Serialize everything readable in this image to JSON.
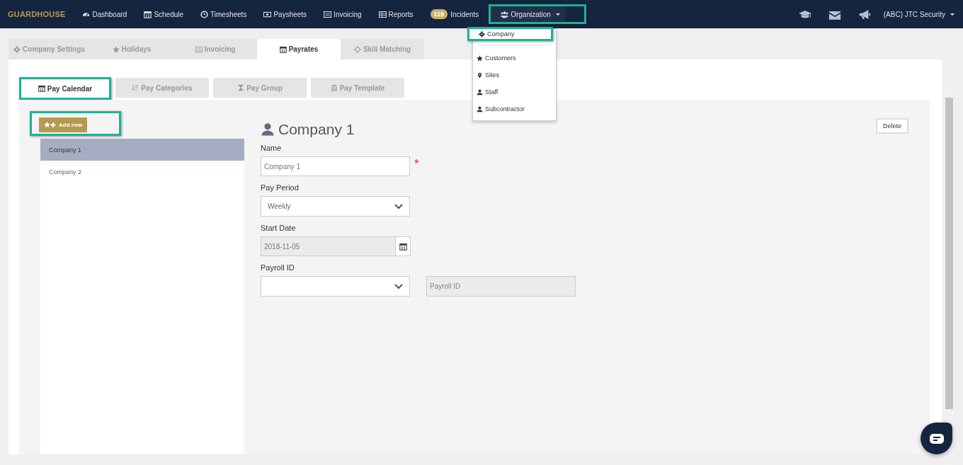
{
  "brand": "GUARDHOUSE",
  "nav": [
    {
      "label": "Dashboard",
      "highlighted": false
    },
    {
      "label": "Schedule",
      "highlighted": false
    },
    {
      "label": "Timesheets",
      "highlighted": false
    },
    {
      "label": "Paysheets",
      "highlighted": false
    },
    {
      "label": "Invoicing",
      "highlighted": false
    },
    {
      "label": "Reports",
      "highlighted": false
    },
    {
      "label": "Incidents",
      "badge": "119",
      "highlighted": false
    },
    {
      "label": "Organization",
      "highlighted": true
    }
  ],
  "account": "(ABC) JTC Security",
  "org_menu": [
    {
      "label": "Company",
      "highlighted": true
    },
    {
      "label": "Customers",
      "highlighted": false
    },
    {
      "label": "Sites",
      "highlighted": false
    },
    {
      "label": "Staff",
      "highlighted": false
    },
    {
      "label": "Subcontractor",
      "highlighted": false
    }
  ],
  "tabs": [
    {
      "label": "Company Settings",
      "selected": false
    },
    {
      "label": "Holidays",
      "selected": false
    },
    {
      "label": "Invoicing",
      "selected": false
    },
    {
      "label": "Payrates",
      "selected": true
    },
    {
      "label": "Skill Matching",
      "selected": false
    }
  ],
  "subtabs": [
    {
      "label": "Pay Calendar",
      "selected": true,
      "highlighted": true
    },
    {
      "label": "Pay Categories",
      "selected": false,
      "highlighted": false
    },
    {
      "label": "Pay Group",
      "selected": false,
      "highlighted": false
    },
    {
      "label": "Pay Template",
      "selected": false,
      "highlighted": false
    }
  ],
  "add_button": {
    "label": "Add new",
    "highlighted": true
  },
  "companies": [
    {
      "label": "Company 1",
      "selected": true
    },
    {
      "label": "Company 2",
      "selected": false
    }
  ],
  "detail": {
    "title": "Company 1",
    "delete": "Delete",
    "fields": [
      {
        "kind": "text",
        "label": "Name",
        "value": "Company 1",
        "required_mark": "*"
      },
      {
        "kind": "select",
        "label": "Pay Period",
        "value": "Weekly"
      },
      {
        "kind": "date",
        "label": "Start Date",
        "value": "2018-11-05",
        "disabled": true
      },
      {
        "kind": "select_pair",
        "label": "Payroll ID",
        "placeholder": "Payroll ID"
      }
    ]
  }
}
